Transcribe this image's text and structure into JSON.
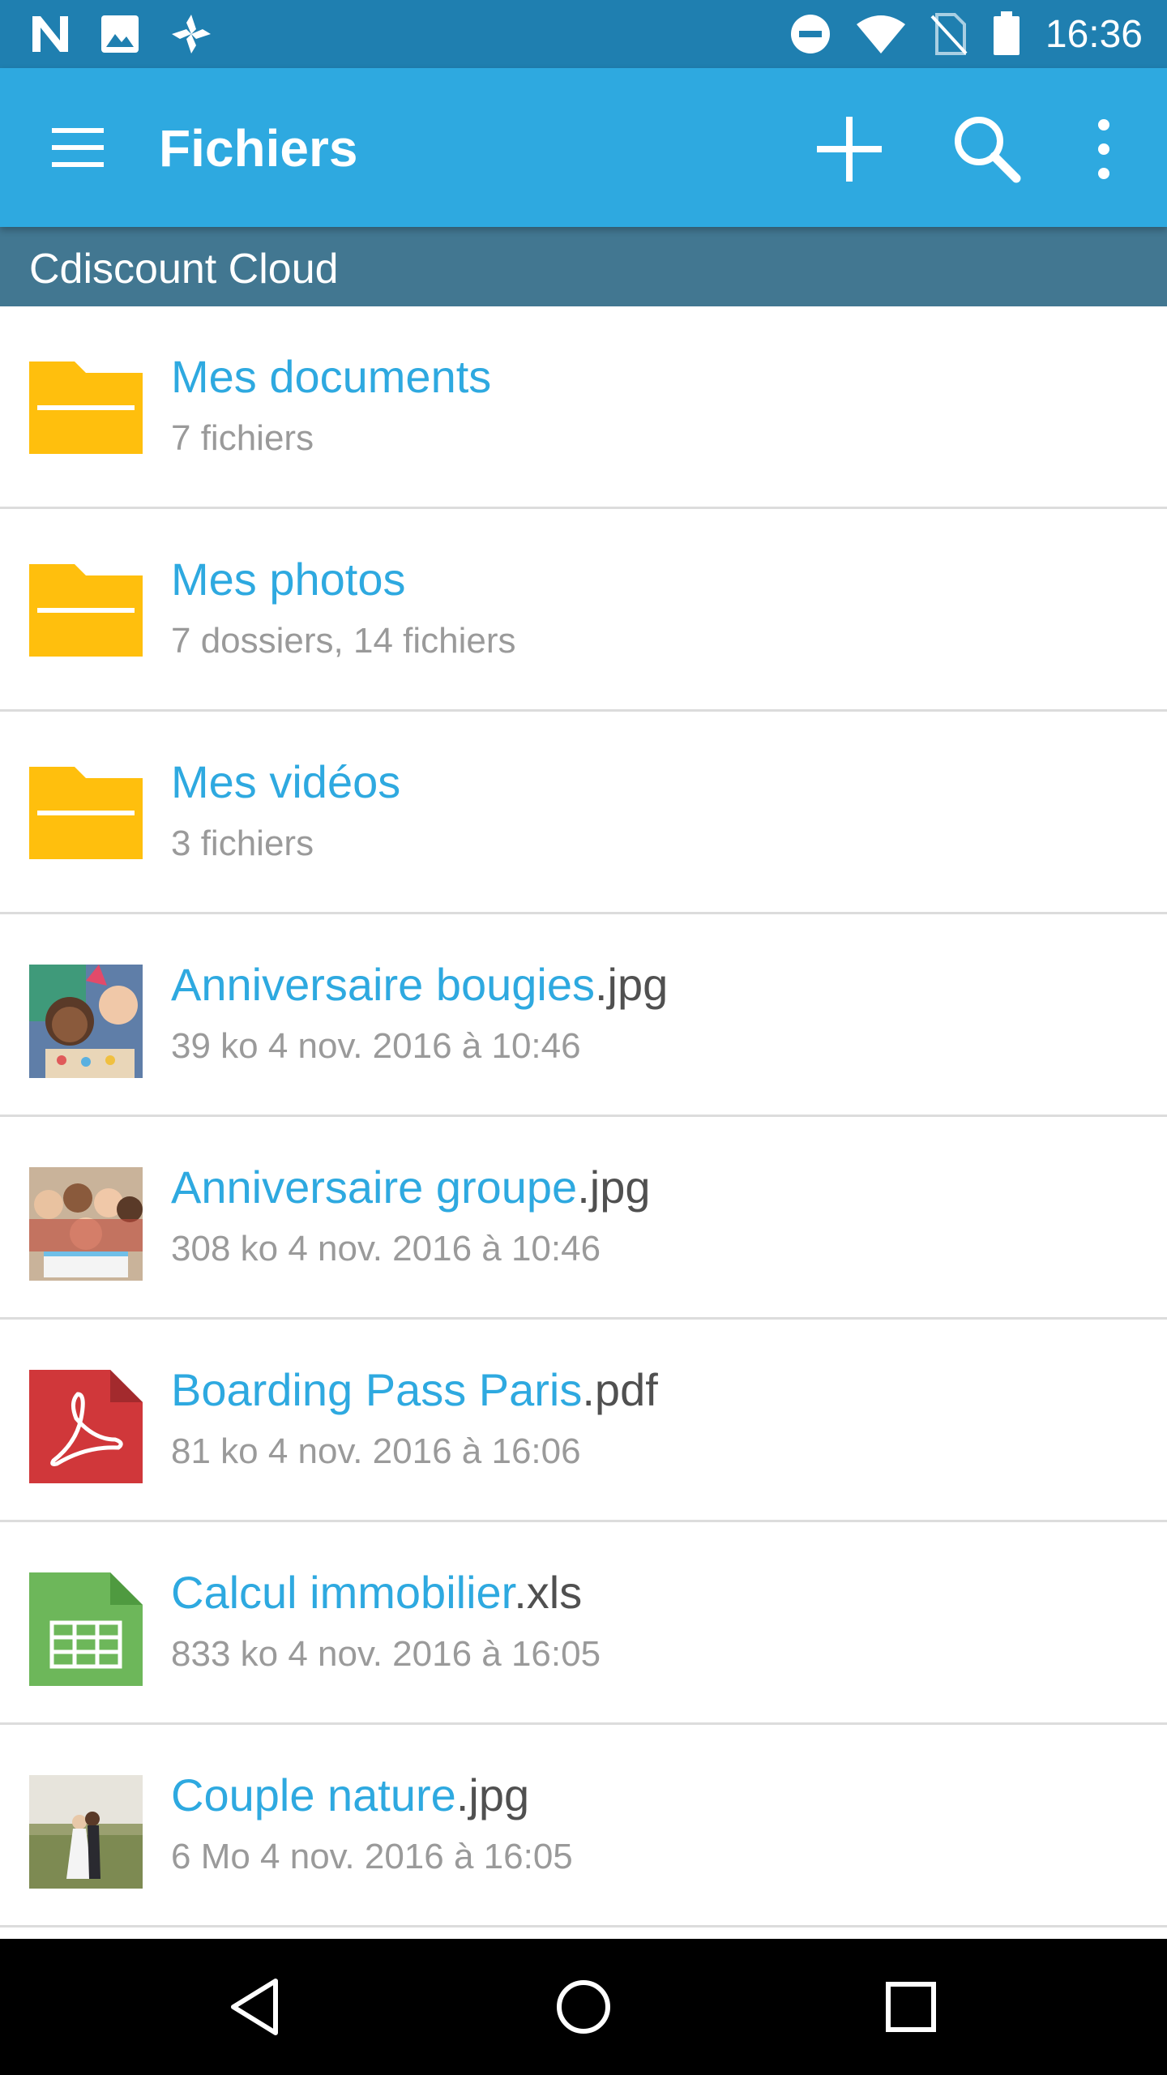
{
  "status_bar": {
    "time": "16:36",
    "left_icons": [
      "n-notification-icon",
      "image-notification-icon",
      "pinwheel-notification-icon"
    ],
    "right_icons": [
      "do-not-disturb-icon",
      "wifi-icon",
      "no-sim-icon",
      "battery-icon"
    ]
  },
  "app_bar": {
    "title": "Fichiers",
    "actions": [
      "add-icon",
      "search-icon",
      "more-vert-icon"
    ],
    "color": "#2ea9e0"
  },
  "breadcrumb": {
    "label": "Cdiscount Cloud"
  },
  "files": [
    {
      "name": "Mes documents",
      "ext": "",
      "meta": "7 fichiers",
      "type": "folder"
    },
    {
      "name": "Mes photos",
      "ext": "",
      "meta": "7 dossiers, 14 fichiers",
      "type": "folder"
    },
    {
      "name": "Mes vidéos",
      "ext": "",
      "meta": "3 fichiers",
      "type": "folder"
    },
    {
      "name": "Anniversaire bougies",
      "ext": ".jpg",
      "meta": "39 ko 4 nov. 2016 à 10:46",
      "type": "image"
    },
    {
      "name": "Anniversaire groupe",
      "ext": ".jpg",
      "meta": "308 ko 4 nov. 2016 à 10:46",
      "type": "image"
    },
    {
      "name": "Boarding Pass Paris",
      "ext": ".pdf",
      "meta": "81 ko 4 nov. 2016 à 16:06",
      "type": "pdf"
    },
    {
      "name": "Calcul immobilier",
      "ext": ".xls",
      "meta": "833 ko 4 nov. 2016 à 16:05",
      "type": "xls"
    },
    {
      "name": "Couple nature",
      "ext": ".jpg",
      "meta": "6 Mo 4 nov. 2016 à 16:05",
      "type": "image"
    }
  ],
  "nav_bar": [
    "back-icon",
    "home-icon",
    "recents-icon"
  ],
  "colors": {
    "accent": "#2ea9e0",
    "status": "#1f7fb0",
    "subheader": "#427791",
    "folder": "#ffbf0d",
    "pdf": "#d0373a",
    "xls": "#6db75a"
  }
}
